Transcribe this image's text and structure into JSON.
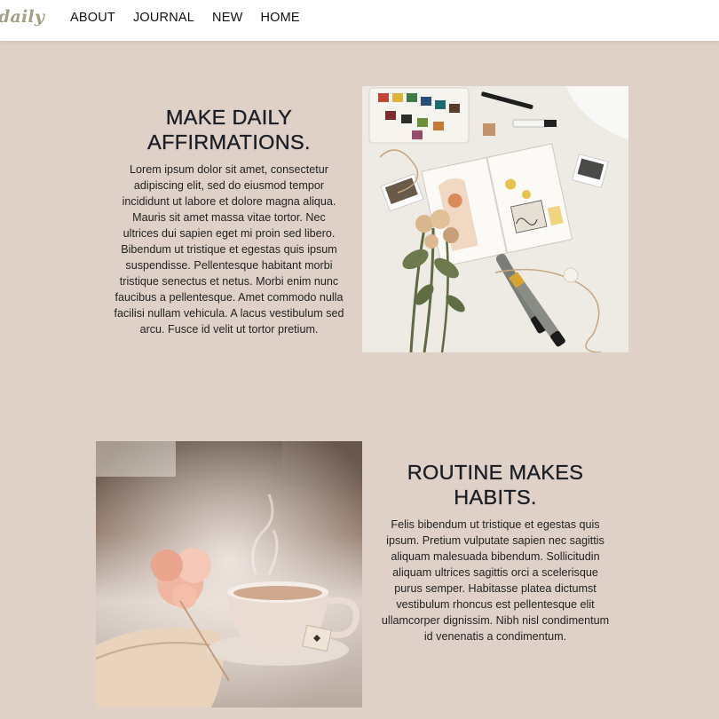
{
  "header": {
    "logo": "daily",
    "nav": [
      "ABOUT",
      "JOURNAL",
      "NEW",
      "HOME"
    ]
  },
  "block1": {
    "heading_line1": "MAKE DAILY",
    "heading_line2": "AFFIRMATIONS.",
    "body": "Lorem ipsum dolor sit amet, consectetur adipiscing elit, sed do eiusmod tempor incididunt ut labore et dolore magna aliqua. Mauris sit amet massa vitae tortor. Nec ultrices dui sapien eget mi proin sed libero. Bibendum ut tristique et egestas quis ipsum suspendisse. Pellentesque habitant morbi tristique senectus et netus. Morbi enim nunc faucibus a pellentesque. Amet commodo nulla facilisi nullam vehicula. A lacus vestibulum sed arcu. Fusce id velit ut tortor pretium."
  },
  "block2": {
    "heading_line1": "ROUTINE MAKES",
    "heading_line2": "HABITS.",
    "body": "Felis bibendum ut tristique et egestas quis ipsum. Pretium vulputate sapien nec sagittis aliquam malesuada bibendum. Sollicitudin aliquam ultrices sagittis orci a scelerisque purus semper. Habitasse platea dictumst vestibulum rhoncus est pellentesque elit ullamcorper dignissim. Nibh nisl condimentum id venenatis a condimentum."
  },
  "colors": {
    "page_background": "#e0d1c8",
    "header_background": "#ffffff",
    "logo": "#a59f86",
    "heading": "#1c1f26"
  }
}
